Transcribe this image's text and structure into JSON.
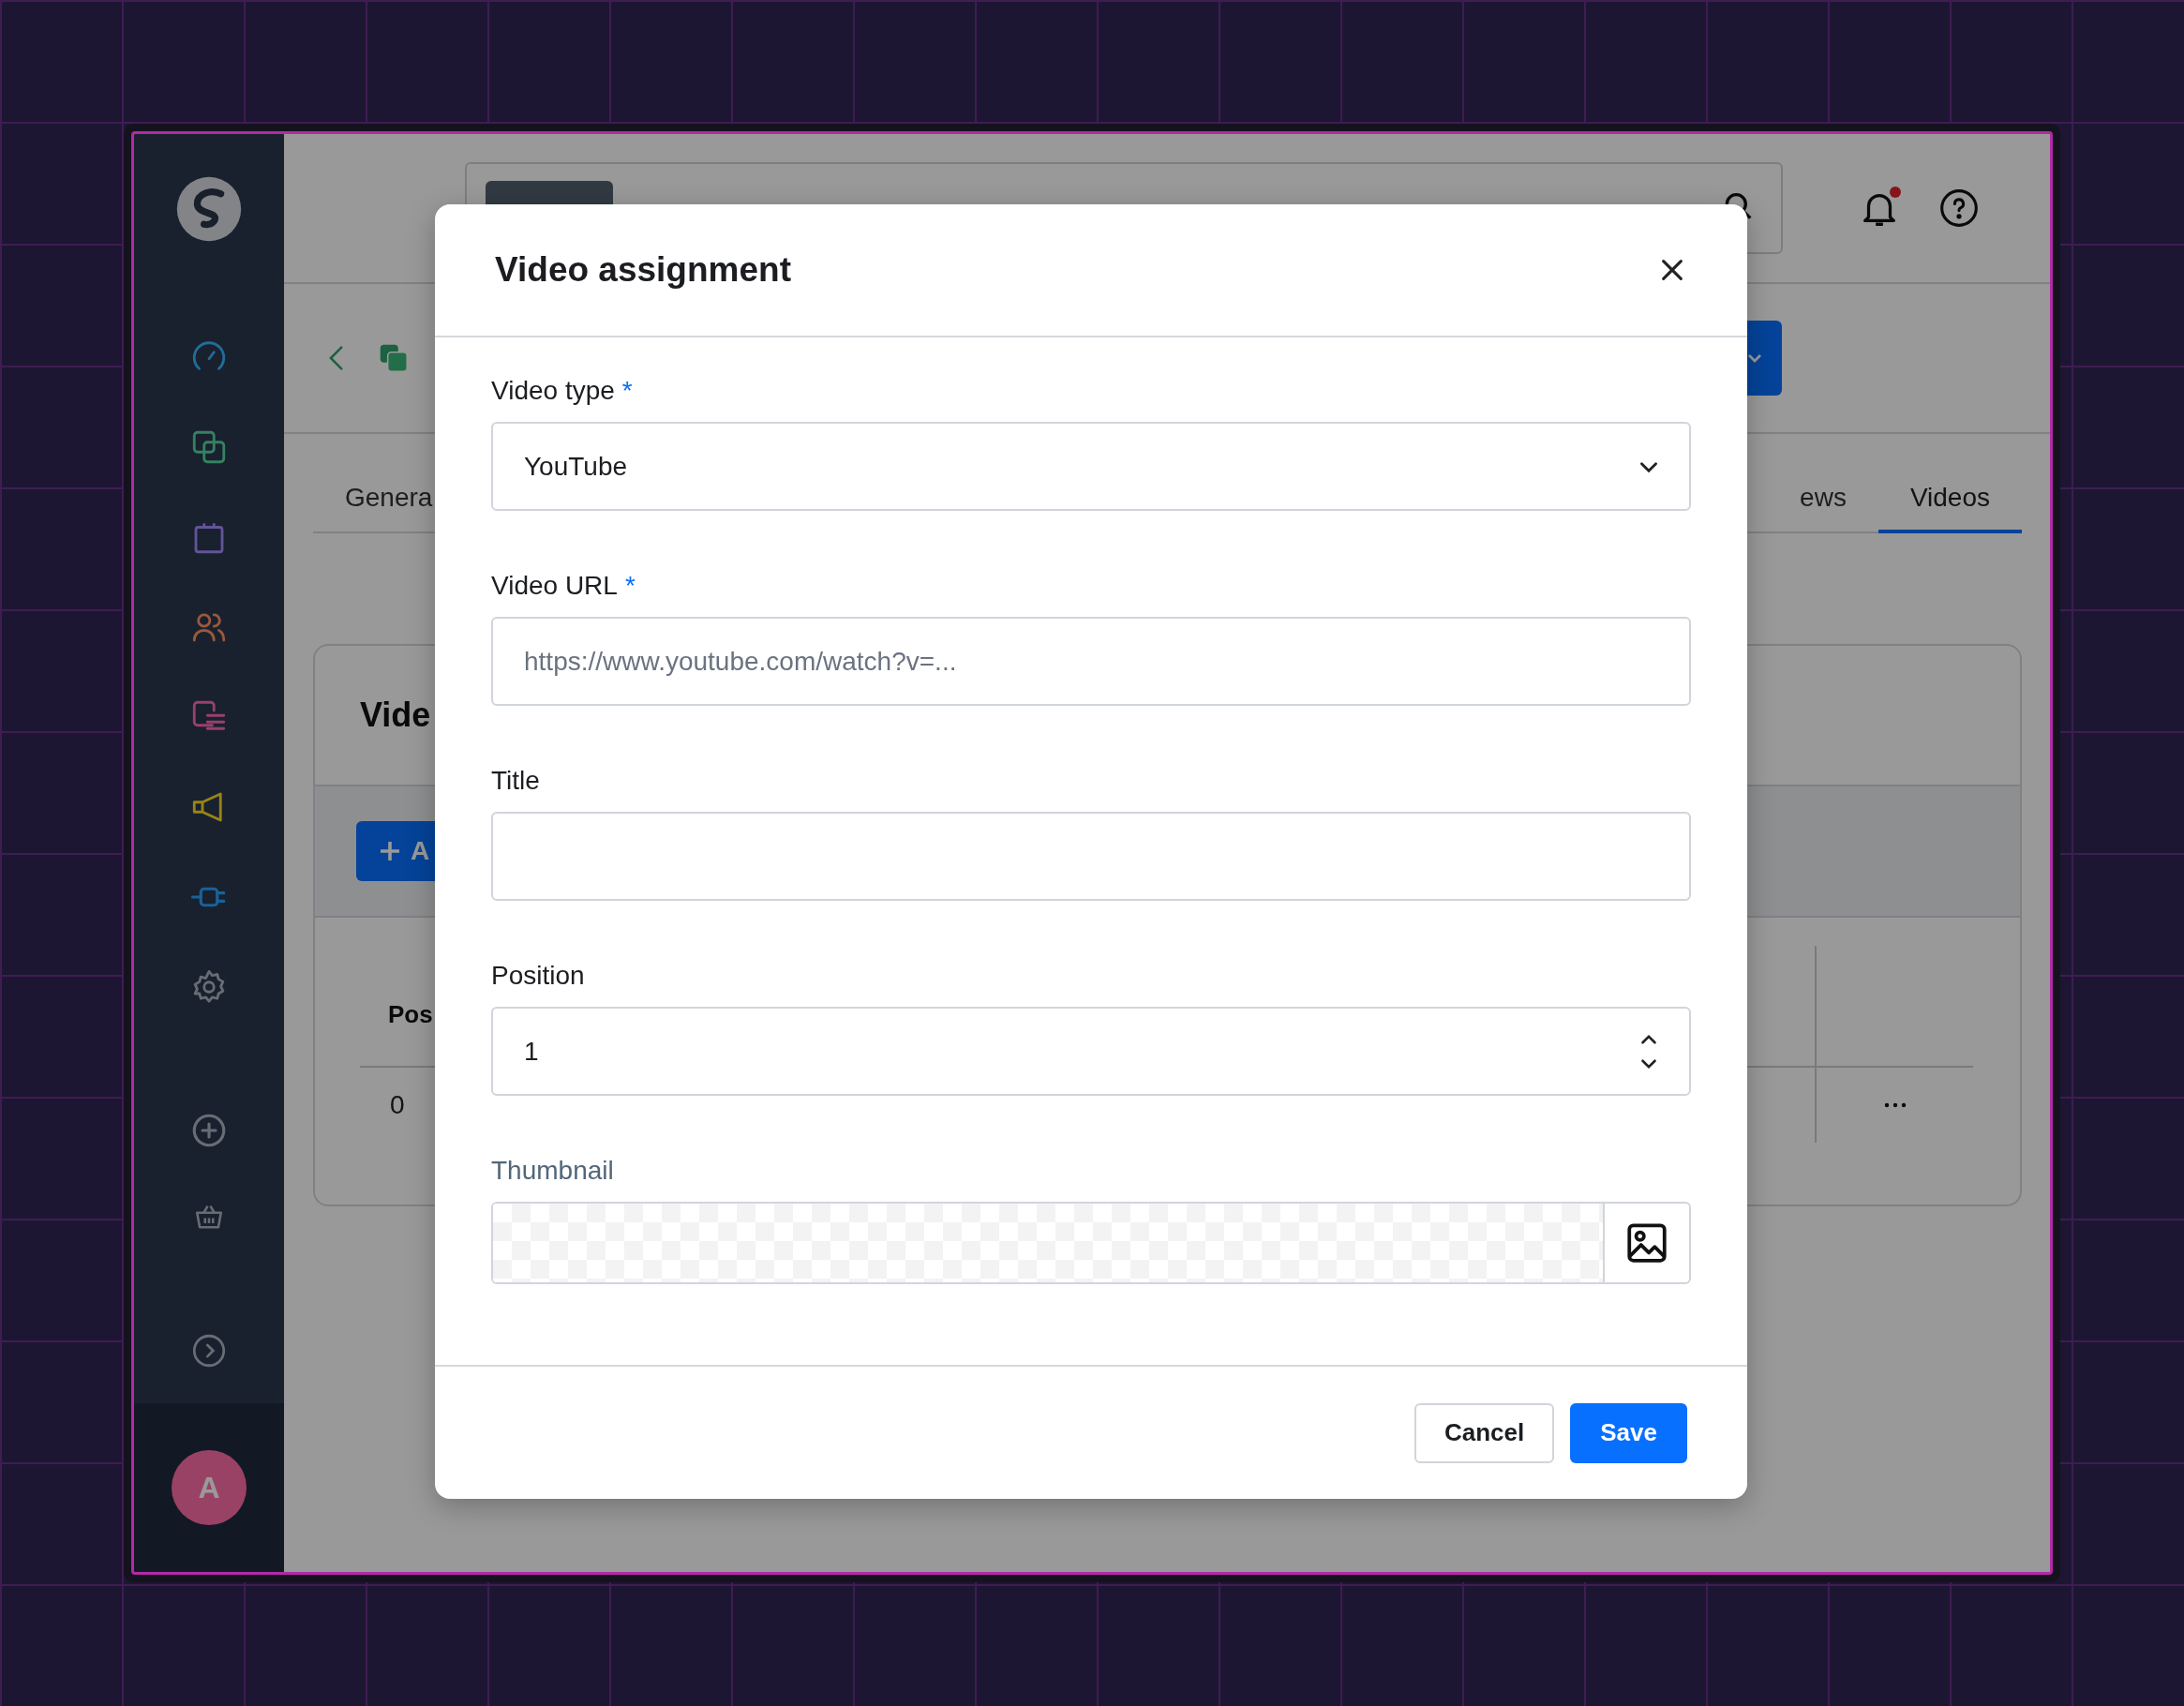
{
  "sidebar": {
    "avatar": "A"
  },
  "header": {
    "has_notifications": true
  },
  "tabs": [
    {
      "label": "Genera",
      "selected": false
    },
    {
      "label": "ews",
      "selected": false
    },
    {
      "label": "Videos",
      "selected": true
    }
  ],
  "card": {
    "title": "Vide",
    "add_button": "A",
    "table": {
      "columns": [
        "Pos"
      ],
      "rows": [
        [
          "0"
        ]
      ]
    }
  },
  "modal": {
    "title": "Video assignment",
    "required_mark": "*",
    "fields": [
      {
        "kind": "select",
        "label": "Video type",
        "required": true,
        "value": "YouTube"
      },
      {
        "kind": "text",
        "label": "Video URL",
        "required": true,
        "placeholder": "https://www.youtube.com/watch?v=..."
      },
      {
        "kind": "text",
        "label": "Title",
        "required": false
      },
      {
        "kind": "number",
        "label": "Position",
        "required": false,
        "value": "1"
      },
      {
        "kind": "image",
        "label": "Thumbnail",
        "required": false
      }
    ],
    "buttons": [
      {
        "label": "Cancel",
        "kind": "secondary"
      },
      {
        "label": "Save",
        "kind": "primary"
      }
    ]
  }
}
